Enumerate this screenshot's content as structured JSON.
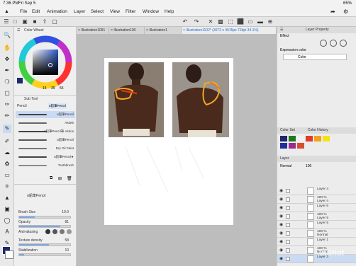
{
  "status": {
    "time": "7:36 PM",
    "date": "Fri Sep 5",
    "battery": "65%"
  },
  "menu": [
    "File",
    "Edit",
    "Animation",
    "Layer",
    "Select",
    "View",
    "Filter",
    "Window",
    "Help"
  ],
  "tabs": [
    {
      "label": "Illustration1091"
    },
    {
      "label": "Illustration100"
    },
    {
      "label": "Illustration1"
    },
    {
      "label": "Illustration1102* (3072 x 4015px 72dpi 34.1%)"
    }
  ],
  "colorWheel": {
    "title": "Color Wheel",
    "h": "14",
    "s": "39",
    "v": "55"
  },
  "subTool": {
    "title": "Sub Tool",
    "group": "Pencil",
    "groupTab": "α鉛筆Pencil",
    "brushes": [
      "α鉛筆Pencil",
      "Akdeb",
      "α鉛筆Pencil筆 Akdos",
      "α鉛筆Pencil",
      "Dry Oil Paint",
      "α鉛筆Pencil★",
      "Toothbrush"
    ]
  },
  "toolProperty": {
    "title": "α鉛筆Pencil",
    "brushSize": {
      "label": "Brush Size",
      "value": "10.0",
      "level": 0.3
    },
    "opacity": {
      "label": "Opacity",
      "value": "81",
      "level": 0.81
    },
    "antiAliasing": {
      "label": "Anti-aliasing"
    },
    "texture": {
      "label": "Texture density",
      "value": "58",
      "level": 0.58
    },
    "stabilization": {
      "label": "Stabilization",
      "value": "10",
      "level": 0.1
    }
  },
  "rightPanel": {
    "propertyTitle": "Layer Property",
    "effectLabel": "Effect",
    "expressionLabel": "Expression color",
    "expressionValue": "Color",
    "colorSetTitle": "Color Set",
    "colorHistoryTitle": "Color History",
    "layerTitle": "Layer",
    "blendMode": "Normal",
    "blendOpacity": "100",
    "layers": [
      {
        "line1": "Layer 4",
        "line2": ""
      },
      {
        "line1": "100 %",
        "line2": "Layer 4"
      },
      {
        "line1": "Layer 6",
        "line2": ""
      },
      {
        "line1": "100 %",
        "line2": "Layer 5"
      },
      {
        "line1": "Layer 5",
        "line2": ""
      },
      {
        "line1": "100 %",
        "line2": "Normal"
      },
      {
        "line1": "Layer 1",
        "line2": ""
      },
      {
        "line1": "100 %",
        "line2": "Normal"
      },
      {
        "line1": "Layer 3",
        "line2": ""
      },
      {
        "line1": "Paper",
        "line2": ""
      }
    ],
    "swatches": [
      "#1c2a6b",
      "#1f7a1f",
      "#f2f2f2",
      "#e23a2a",
      "#f2a11d",
      "#f5e21b",
      "#1f2f9a",
      "#9c2a8f",
      "#d84d2f"
    ]
  },
  "watermark": "InShot"
}
